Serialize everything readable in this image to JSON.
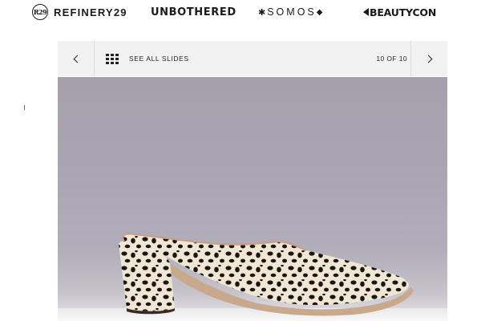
{
  "brands": {
    "refinery29": {
      "logo_text": "R29",
      "label": "REFINERY29"
    },
    "unbothered": {
      "label": "UNBOTHERED"
    },
    "somos": {
      "label": "SOMOS"
    },
    "beautycon": {
      "label": "BEAUTYCON"
    }
  },
  "slideshow": {
    "see_all_label": "SEE ALL SLIDES",
    "counter": "10 OF 10",
    "prev_icon": "chevron-left-icon",
    "next_icon": "chevron-right-icon",
    "grid_icon": "grid-icon"
  },
  "colors": {
    "background_top": "#a5a0ac",
    "nav_bar": "#f2f2f2"
  }
}
